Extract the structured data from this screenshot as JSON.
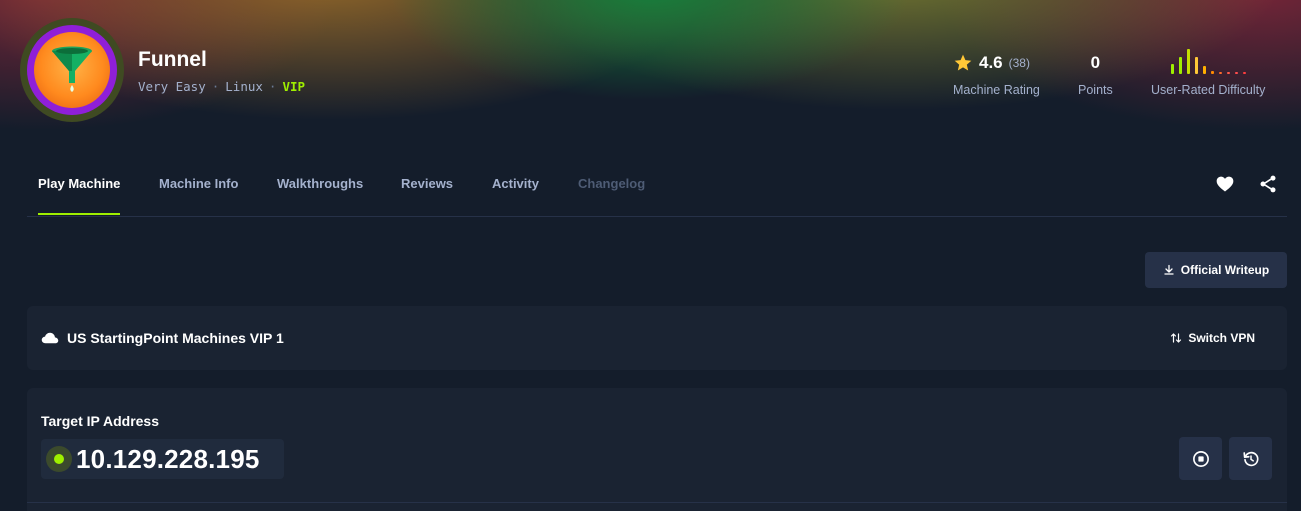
{
  "machine": {
    "name": "Funnel",
    "difficulty": "Very Easy",
    "os": "Linux",
    "tier": "VIP",
    "meta_separator": "·",
    "avatar_icon": "funnel-icon"
  },
  "stats": {
    "rating_value": "4.6",
    "rating_count": "(38)",
    "rating_label": "Machine Rating",
    "points_value": "0",
    "points_label": "Points",
    "difficulty_label": "User-Rated Difficulty",
    "difficulty_distribution": [
      0.35,
      0.6,
      0.9,
      0.6,
      0.3,
      0.12,
      0.06,
      0.05,
      0.04,
      0.04
    ],
    "difficulty_colors": [
      "#9fef00",
      "#9fef00",
      "#c5e000",
      "#ffc837",
      "#ffaf00",
      "#ff8a00",
      "#ff6a2a",
      "#ff5a4a",
      "#ff4d4d",
      "#ff3e3e"
    ]
  },
  "tabs": [
    {
      "label": "Play Machine",
      "state": "active"
    },
    {
      "label": "Machine Info",
      "state": "normal"
    },
    {
      "label": "Walkthroughs",
      "state": "normal"
    },
    {
      "label": "Reviews",
      "state": "normal"
    },
    {
      "label": "Activity",
      "state": "normal"
    },
    {
      "label": "Changelog",
      "state": "disabled"
    }
  ],
  "actions": {
    "favorite_icon": "heart-icon",
    "share_icon": "share-icon",
    "writeup_label": "Official Writeup"
  },
  "vpn": {
    "server": "US StartingPoint Machines VIP 1",
    "switch_label": "Switch VPN"
  },
  "target": {
    "label": "Target IP Address",
    "ip": "10.129.228.195",
    "status": "online"
  },
  "colors": {
    "accent": "#9fef00",
    "background": "#141d2b",
    "panel": "#1a2332",
    "button": "#263148",
    "muted_text": "#a4b1cd",
    "star": "#ffc837"
  }
}
